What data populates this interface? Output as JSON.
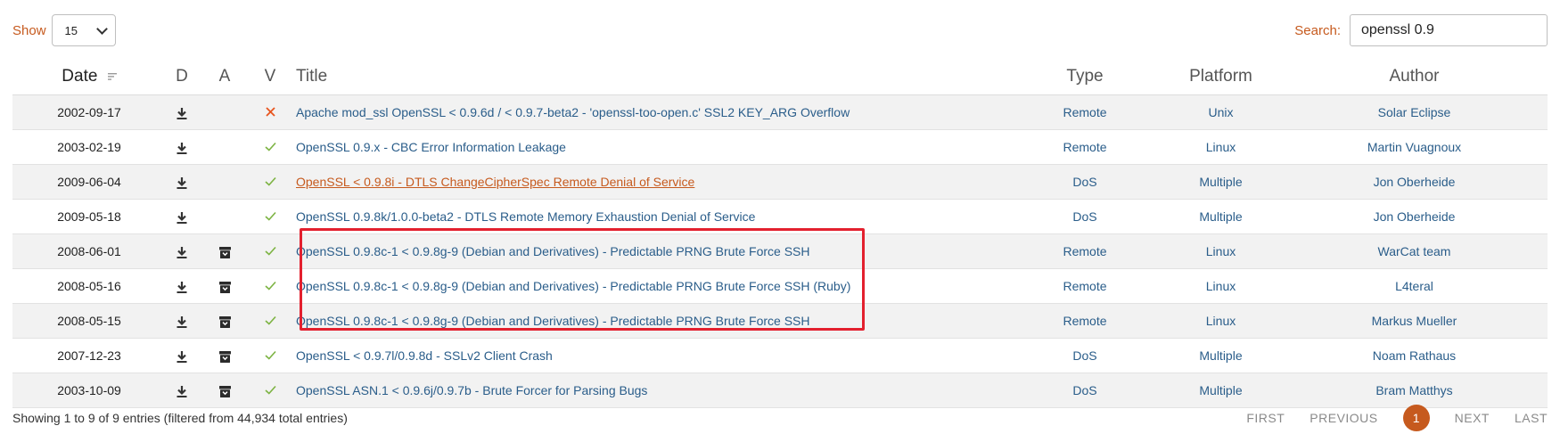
{
  "controls": {
    "show_label": "Show",
    "page_size": "15",
    "search_label": "Search:",
    "search_value": "openssl 0.9"
  },
  "table": {
    "headers": {
      "date": "Date",
      "d": "D",
      "a": "A",
      "v": "V",
      "title": "Title",
      "type": "Type",
      "platform": "Platform",
      "author": "Author"
    },
    "rows": [
      {
        "date": "2002-09-17",
        "download": true,
        "archive": false,
        "verified": false,
        "title": "Apache mod_ssl OpenSSL < 0.9.6d / < 0.9.7-beta2 - 'openssl-too-open.c' SSL2 KEY_ARG Overflow",
        "type": "Remote",
        "platform": "Unix",
        "author": "Solar Eclipse"
      },
      {
        "date": "2003-02-19",
        "download": true,
        "archive": false,
        "verified": true,
        "title": "OpenSSL 0.9.x - CBC Error Information Leakage",
        "type": "Remote",
        "platform": "Linux",
        "author": "Martin Vuagnoux"
      },
      {
        "date": "2009-06-04",
        "download": true,
        "archive": false,
        "verified": true,
        "title": "OpenSSL < 0.9.8i - DTLS ChangeCipherSpec Remote Denial of Service",
        "type": "DoS",
        "platform": "Multiple",
        "author": "Jon Oberheide",
        "hovered": true
      },
      {
        "date": "2009-05-18",
        "download": true,
        "archive": false,
        "verified": true,
        "title": "OpenSSL 0.9.8k/1.0.0-beta2 - DTLS Remote Memory Exhaustion Denial of Service",
        "type": "DoS",
        "platform": "Multiple",
        "author": "Jon Oberheide"
      },
      {
        "date": "2008-06-01",
        "download": true,
        "archive": true,
        "verified": true,
        "title": "OpenSSL 0.9.8c-1 < 0.9.8g-9 (Debian and Derivatives) - Predictable PRNG Brute Force SSH",
        "type": "Remote",
        "platform": "Linux",
        "author": "WarCat team"
      },
      {
        "date": "2008-05-16",
        "download": true,
        "archive": true,
        "verified": true,
        "title": "OpenSSL 0.9.8c-1 < 0.9.8g-9 (Debian and Derivatives) - Predictable PRNG Brute Force SSH (Ruby)",
        "type": "Remote",
        "platform": "Linux",
        "author": "L4teral"
      },
      {
        "date": "2008-05-15",
        "download": true,
        "archive": true,
        "verified": true,
        "title": "OpenSSL 0.9.8c-1 < 0.9.8g-9 (Debian and Derivatives) - Predictable PRNG Brute Force SSH",
        "type": "Remote",
        "platform": "Linux",
        "author": "Markus Mueller"
      },
      {
        "date": "2007-12-23",
        "download": true,
        "archive": true,
        "verified": true,
        "title": "OpenSSL < 0.9.7l/0.9.8d - SSLv2 Client Crash",
        "type": "DoS",
        "platform": "Multiple",
        "author": "Noam Rathaus"
      },
      {
        "date": "2003-10-09",
        "download": true,
        "archive": true,
        "verified": true,
        "title": "OpenSSL ASN.1 < 0.9.6j/0.9.7b - Brute Forcer for Parsing Bugs",
        "type": "DoS",
        "platform": "Multiple",
        "author": "Bram Matthys"
      }
    ]
  },
  "footer": {
    "info": "Showing 1 to 9 of 9 entries (filtered from 44,934 total entries)",
    "first": "FIRST",
    "previous": "PREVIOUS",
    "current_page": "1",
    "next": "NEXT",
    "last": "LAST"
  },
  "colors": {
    "accent": "#c65a1e",
    "link": "#2a5d8a",
    "verified": "#7cb342",
    "unverified": "#e8551f",
    "highlight": "#e3202e"
  }
}
